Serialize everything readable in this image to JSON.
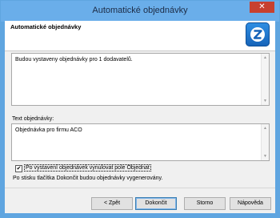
{
  "window": {
    "title": "Automatické objednávky",
    "close_symbol": "✕"
  },
  "header": {
    "title": "Automatické objednávky",
    "logo_letter": "Z"
  },
  "summary": {
    "text": "Budou vystaveny objednávky pro 1 dodavatelů."
  },
  "order_text": {
    "label": "Text objednávky:",
    "value": "Objednávka pro firmu ACO"
  },
  "reset_option": {
    "label": "Po vystavení objednávek vynulovat pole Objednat",
    "checked": true,
    "check_mark": "✔"
  },
  "info": {
    "text": "Po stisku tlačítka Dokončit budou objednávky vygenerovány."
  },
  "buttons": {
    "back": "< Zpět",
    "finish": "Dokončit",
    "cancel": "Storno",
    "help": "Nápověda"
  },
  "colors": {
    "accent": "#6aaeea",
    "close": "#c7402f",
    "logo": "#1f78d1"
  }
}
